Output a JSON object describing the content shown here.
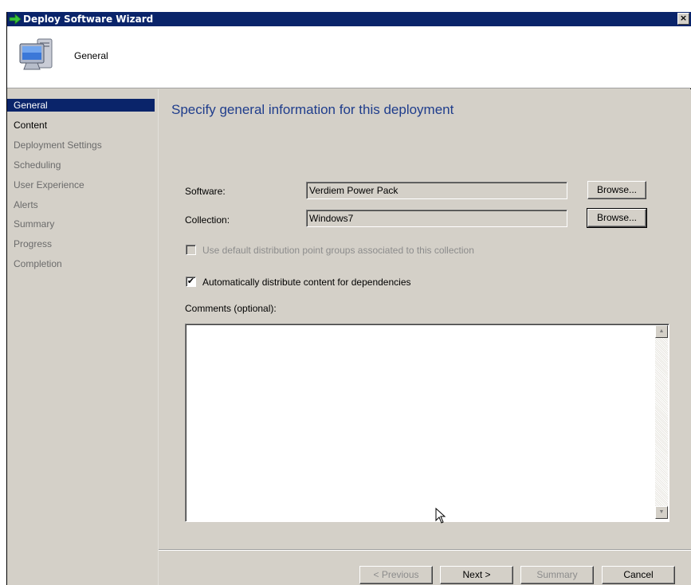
{
  "window": {
    "title": "Deploy Software Wizard",
    "close_label": "×"
  },
  "header": {
    "title": "General"
  },
  "sidebar": {
    "items": [
      {
        "label": "General",
        "state": "active"
      },
      {
        "label": "Content",
        "state": "done"
      },
      {
        "label": "Deployment Settings",
        "state": "pending"
      },
      {
        "label": "Scheduling",
        "state": "pending"
      },
      {
        "label": "User Experience",
        "state": "pending"
      },
      {
        "label": "Alerts",
        "state": "pending"
      },
      {
        "label": "Summary",
        "state": "pending"
      },
      {
        "label": "Progress",
        "state": "pending"
      },
      {
        "label": "Completion",
        "state": "pending"
      }
    ]
  },
  "main": {
    "heading": "Specify general information for this deployment",
    "software_label": "Software:",
    "software_value": "Verdiem Power Pack",
    "collection_label": "Collection:",
    "collection_value": "Windows7",
    "browse_label": "Browse...",
    "use_default_dp_label": "Use default distribution point groups associated to this collection",
    "use_default_dp_checked": false,
    "auto_distribute_label": "Automatically distribute content for dependencies",
    "auto_distribute_checked": true,
    "check_mark": "✔",
    "comments_label": "Comments (optional):",
    "comments_value": ""
  },
  "footer": {
    "previous_label": "< Previous",
    "next_label": "Next >",
    "summary_label": "Summary",
    "cancel_label": "Cancel"
  },
  "icons": {
    "scroll_up": "▲",
    "scroll_down": "▼"
  },
  "colors": {
    "titlebar": "#0a246a",
    "heading": "#1f3d8c",
    "chrome": "#d4d0c8"
  }
}
